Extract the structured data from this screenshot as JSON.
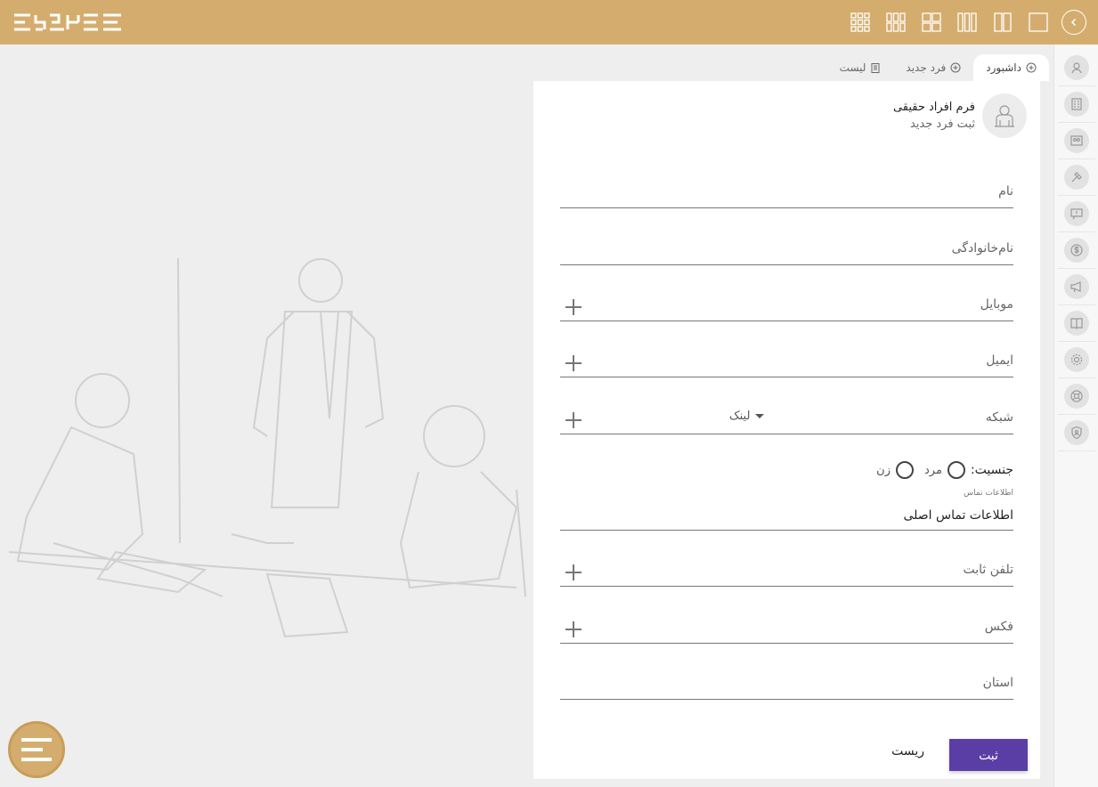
{
  "brand": {
    "accent": "#d4ad6e",
    "primary_button": "#5b3ea5"
  },
  "topbar": {
    "icons": [
      "grid-3x3-icon",
      "grid-3x2-icon",
      "grid-2x2-icon",
      "columns-3-icon",
      "columns-2-icon",
      "single-pane-icon",
      "back-circle-icon"
    ]
  },
  "tabs": [
    {
      "label": "داشبورد",
      "icon": "plus-circle-icon",
      "active": true
    },
    {
      "label": "فرد جدید",
      "icon": "plus-circle-icon",
      "active": false
    },
    {
      "label": "لیست",
      "icon": "clipboard-icon",
      "active": false
    }
  ],
  "form": {
    "title": "فرم افراد حقیقی",
    "subtitle": "ثبت فرد جدید",
    "fields": {
      "first_name": "نام",
      "last_name": "نام‌خانوادگی",
      "mobile": "موبایل",
      "email": "ایمیل",
      "network": "شبکه",
      "network_select": "لینک",
      "landline": "تلفن ثابت",
      "fax": "فکس",
      "province": "استان"
    },
    "gender": {
      "label": "جنسیت:",
      "male": "مرد",
      "female": "زن"
    },
    "contact": {
      "caption": "اطلاعات تماس",
      "value": "اطلاعات تماس اصلی"
    },
    "submit": "ثبت",
    "reset": "ریست"
  },
  "sidebar": {
    "items": [
      "user-circle-icon",
      "building-icon",
      "people-icon",
      "hammer-icon",
      "alert-message-icon",
      "dollar-icon",
      "megaphone-icon",
      "book-icon",
      "gear-icon",
      "lifebuoy-icon",
      "shield-user-icon"
    ]
  }
}
